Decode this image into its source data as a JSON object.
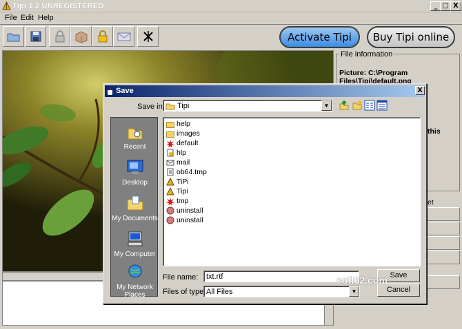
{
  "window": {
    "title": "Tipi 1.2 UNREGISTERED",
    "min": "_",
    "max": "□",
    "close": "X"
  },
  "menu": [
    "File",
    "Edit",
    "Help"
  ],
  "toolbar": {
    "activate": "Activate Tipi",
    "buy": "Buy Tipi online"
  },
  "info": {
    "legend": "File information",
    "picture_label": "Picture: C:\\Program Files\\Tipi\\default.png",
    "fragment": "this",
    "reset": "et password"
  },
  "dialog": {
    "title": "Save",
    "close": "X",
    "save_in_label": "Save in:",
    "save_in_value": "Tipi",
    "places": [
      "Recent",
      "Desktop",
      "My Documents",
      "My Computer",
      "My Network Places"
    ],
    "files": [
      {
        "name": "help",
        "icon": "folder-icon"
      },
      {
        "name": "images",
        "icon": "folder-icon"
      },
      {
        "name": "default",
        "icon": "splat-icon"
      },
      {
        "name": "hlp",
        "icon": "help-file-icon"
      },
      {
        "name": "mail",
        "icon": "mail-file-icon"
      },
      {
        "name": "ob64.tmp",
        "icon": "file-icon"
      },
      {
        "name": "TiPi",
        "icon": "tipi-icon"
      },
      {
        "name": "Tipi",
        "icon": "tipi-icon"
      },
      {
        "name": "tmp",
        "icon": "splat-icon"
      },
      {
        "name": "uninstall",
        "icon": "uninstall-icon"
      },
      {
        "name": "uninstall",
        "icon": "uninstall-icon"
      }
    ],
    "file_name_label": "File name:",
    "file_name_value": "txt.rtf",
    "file_type_label": "Files of type:",
    "file_type_value": "All Files",
    "save": "Save",
    "cancel": "Cancel"
  },
  "watermark": "soft32.com"
}
